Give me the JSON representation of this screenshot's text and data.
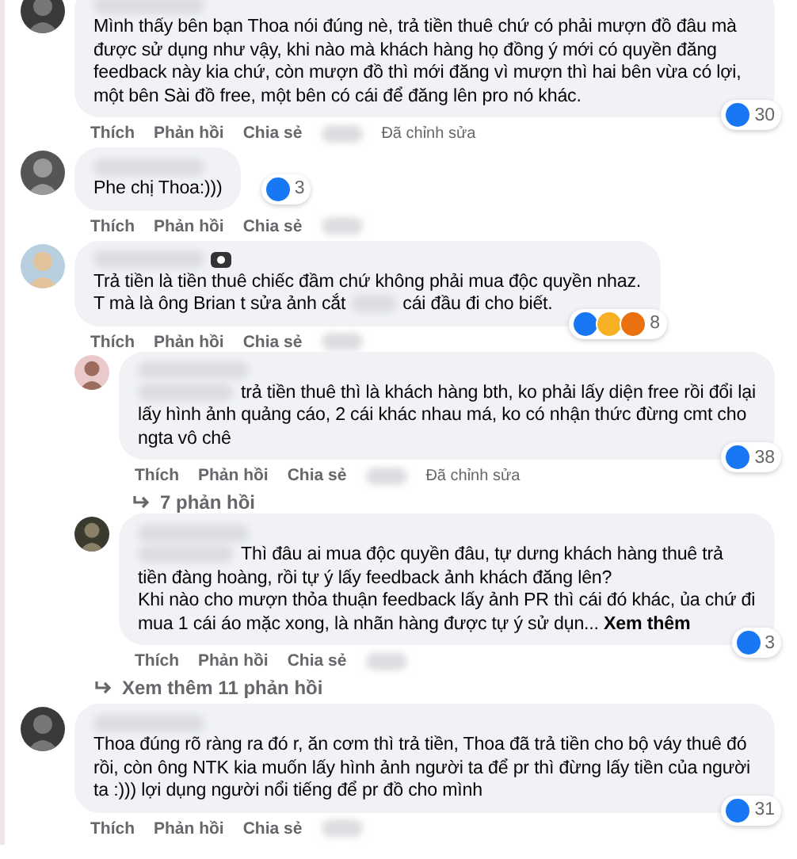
{
  "comments": [
    {
      "mention": false,
      "name_badge": false,
      "text": "Mình thấy bên bạn Thoa nói đúng nè, trả tiền thuê chứ có phải mượn đồ đâu mà được sử dụng như vậy, khi nào mà khách hàng họ đồng ý mới có quyền đăng feedback này kia chứ, còn mượn đồ thì mới đăng vì mượn thì hai bên vừa có lợi, một bên Sài đồ free, một bên có cái để đăng lên pro nó khác.",
      "reactions": [
        {
          "kind": "like"
        }
      ],
      "count": "30",
      "actions": [
        "Thích",
        "Phản hồi",
        "Chia sẻ"
      ],
      "edited": "Đã chỉnh sửa"
    },
    {
      "mention": false,
      "name_badge": false,
      "text": "Phe chị Thoa:)))",
      "reactions": [
        {
          "kind": "like"
        }
      ],
      "count": "3",
      "actions": [
        "Thích",
        "Phản hồi",
        "Chia sẻ"
      ]
    },
    {
      "mention": false,
      "name_badge": true,
      "text": "Trả tiền là tiền thuê chiếc đầm chứ không phải mua độc quyền nhaz.\nT mà là ông Brian t sửa ảnh cắt",
      "text_after": "cái đầu đi cho biết.",
      "reactions": [
        {
          "kind": "like"
        },
        {
          "kind": "haha"
        },
        {
          "kind": "angry"
        }
      ],
      "count": "8",
      "actions": [
        "Thích",
        "Phản hồi",
        "Chia sẻ"
      ],
      "replies": [
        {
          "mention": true,
          "name_badge": false,
          "text": "trả tiền thuê thì là khách hàng bth, ko phải lấy diện free rồi đổi lại lấy hình ảnh quảng cáo, 2 cái khác nhau má, ko có nhận thức đừng cmt cho ngta vô chê",
          "reactions": [
            {
              "kind": "like"
            }
          ],
          "count": "38",
          "actions": [
            "Thích",
            "Phản hồi",
            "Chia sẻ"
          ],
          "edited": "Đã chỉnh sửa",
          "more": "7 phản hồi"
        },
        {
          "mention": true,
          "name_badge": false,
          "text": "Thì đâu ai mua độc quyền đâu, tự dưng khách hàng thuê trả tiền đàng hoàng, rồi tự ý lấy feedback ảnh khách đăng lên?\nKhi nào cho mượn thỏa thuận feedback lấy ảnh PR thì cái đó khác, ủa chứ đi mua 1 cái áo mặc xong, là nhãn hàng được tự ý sử dụn...",
          "see_more": "Xem thêm",
          "reactions": [
            {
              "kind": "like"
            }
          ],
          "count": "3",
          "actions": [
            "Thích",
            "Phản hồi",
            "Chia sẻ"
          ]
        }
      ],
      "more_replies": "Xem thêm 11 phản hồi"
    },
    {
      "mention": false,
      "name_badge": false,
      "text": "Thoa đúng rõ ràng ra đó r, ăn cơm thì trả tiền, Thoa đã trả tiền cho bộ váy thuê đó rồi, còn ông NTK kia muốn lấy hình ảnh người ta để pr thì đừng lấy tiền của người ta :))) lợi dụng người nổi tiếng để pr đồ cho mình",
      "reactions": [
        {
          "kind": "like"
        }
      ],
      "count": "31",
      "actions": [
        "Thích",
        "Phản hồi",
        "Chia sẻ"
      ]
    }
  ]
}
